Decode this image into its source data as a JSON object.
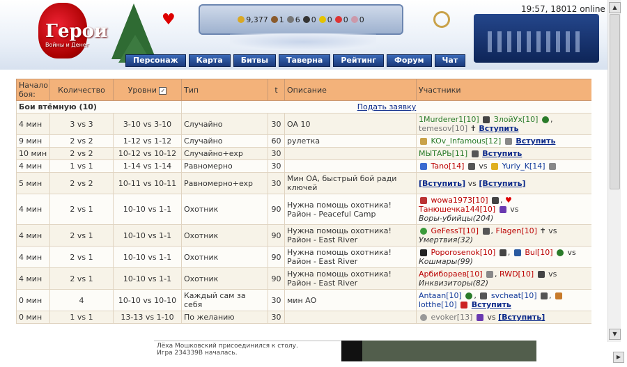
{
  "header": {
    "clock": "19:57, 18012 online",
    "logo_text": "Герои",
    "logo_sub": "Войны и Денег",
    "resources": [
      {
        "name": "gold",
        "value": "9,377",
        "color": "#d9a824"
      },
      {
        "name": "wood",
        "value": "1",
        "color": "#8a5a2b"
      },
      {
        "name": "ore",
        "value": "6",
        "color": "#777777"
      },
      {
        "name": "mercury",
        "value": "0",
        "color": "#333333"
      },
      {
        "name": "sulfur",
        "value": "0",
        "color": "#e5c300"
      },
      {
        "name": "crystal",
        "value": "0",
        "color": "#d33"
      },
      {
        "name": "gems",
        "value": "0",
        "color": "#c9a"
      }
    ]
  },
  "nav": [
    {
      "label": "Персонаж"
    },
    {
      "label": "Карта"
    },
    {
      "label": "Битвы"
    },
    {
      "label": "Таверна"
    },
    {
      "label": "Рейтинг"
    },
    {
      "label": "Форум"
    },
    {
      "label": "Чат"
    }
  ],
  "table": {
    "headers": {
      "start": "Начало боя:",
      "count": "Количество",
      "levels": "Уровни",
      "type": "Тип",
      "t": "t",
      "desc": "Описание",
      "participants": "Участники"
    },
    "section_title": "Бои втёмную (10)",
    "submit_link": "Подать заявку",
    "rows": [
      {
        "start": "4 мин",
        "count": "3 vs 3",
        "levels": "3-10 vs 3-10",
        "type": "Случайно",
        "t": "30",
        "desc": "OA 10",
        "p1": "1Murderer1[10]",
        "p2": "ЗлойУх[10]",
        "p3": "temesov[10]",
        "join": "Вступить"
      },
      {
        "start": "9 мин",
        "count": "2 vs 2",
        "levels": "1-12 vs 1-12",
        "type": "Случайно",
        "t": "60",
        "desc": "рулетка",
        "p1": "KOv_Infamous[12]",
        "join": "Вступить"
      },
      {
        "start": "10 мин",
        "count": "2 vs 2",
        "levels": "10-12 vs 10-12",
        "type": "Случайно+exp",
        "t": "30",
        "desc": "",
        "p1": "МЫТАРЬ[11]",
        "join": "Вступить"
      },
      {
        "start": "4 мин",
        "count": "1 vs 1",
        "levels": "1-14 vs 1-14",
        "type": "Равномерно",
        "t": "30",
        "desc": "",
        "p1": "Tano[14]",
        "vs": "vs",
        "p2": "Yuriy_K[14]"
      },
      {
        "start": "5 мин",
        "count": "2 vs 2",
        "levels": "10-11 vs 10-11",
        "type": "Равномерно+exp",
        "t": "30",
        "desc": "Мин ОА, быстрый бой ради ключей",
        "join1": "[Вступить]",
        "vs": "vs",
        "join2": "[Вступить]"
      },
      {
        "start": "4 мин",
        "count": "2 vs 1",
        "levels": "10-10 vs 1-1",
        "type": "Охотник",
        "t": "90",
        "desc": "Нужна помощь охотника! Район - Peaceful Camp",
        "p1": "wowa1973[10]",
        "p2": "Танюшечка144[10]",
        "vs": "vs",
        "guild": "Воры-убийцы(204)"
      },
      {
        "start": "4 мин",
        "count": "2 vs 1",
        "levels": "10-10 vs 1-1",
        "type": "Охотник",
        "t": "90",
        "desc": "Нужна помощь охотника! Район - East River",
        "p1": "GeFessT[10]",
        "p2": "Flagen[10]",
        "vs": "vs",
        "guild": "Умертвия(32)"
      },
      {
        "start": "4 мин",
        "count": "2 vs 1",
        "levels": "10-10 vs 1-1",
        "type": "Охотник",
        "t": "90",
        "desc": "Нужна помощь охотника! Район - East River",
        "p1": "Poporosenok[10]",
        "p2": "Bul[10]",
        "vs": "vs",
        "guild": "Кошмары(99)"
      },
      {
        "start": "4 мин",
        "count": "2 vs 1",
        "levels": "10-10 vs 1-1",
        "type": "Охотник",
        "t": "90",
        "desc": "Нужна помощь охотника! Район - East River",
        "p1": "Арбиборaев[10]",
        "p2": "RWD[10]",
        "vs": "vs",
        "guild": "Инквизиторы(82)"
      },
      {
        "start": "0 мин",
        "count": "4",
        "levels": "10-10 vs 10-10",
        "type": "Каждый сам за себя",
        "t": "30",
        "desc": "мин АО",
        "p1": "Antaan[10]",
        "p2": "svcheat[10]",
        "p3": "lotthe[10]",
        "join": "Вступить"
      },
      {
        "start": "0 мин",
        "count": "1 vs 1",
        "levels": "13-13 vs 1-10",
        "type": "По желанию",
        "t": "30",
        "desc": "",
        "p1": "evoker[13]",
        "vs": "vs",
        "join": "[Вступить]"
      }
    ]
  },
  "chat": {
    "line1": "Лёха Мошковский присоединился к столу.",
    "line2": "Игра 234339В началась."
  }
}
